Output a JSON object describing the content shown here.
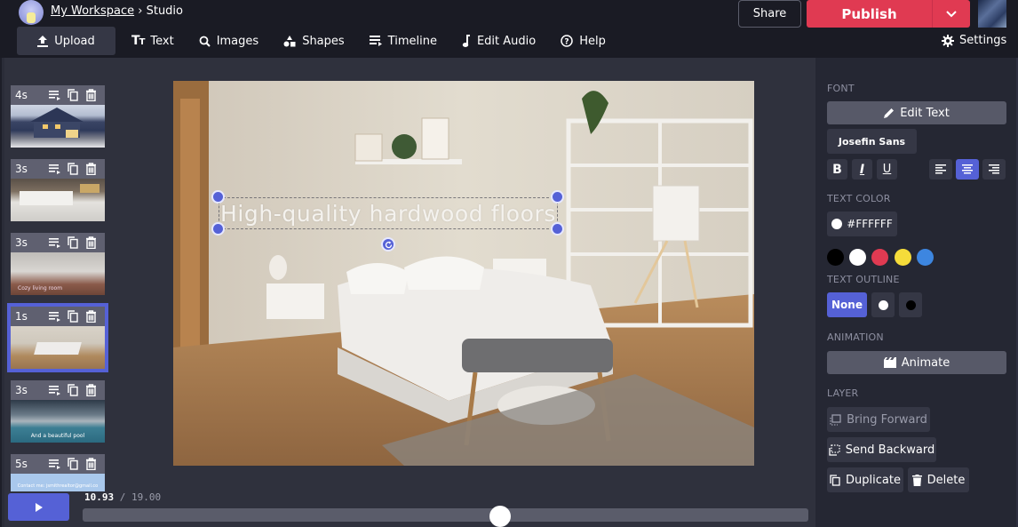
{
  "header": {
    "breadcrumb": {
      "workspace": "My Workspace",
      "separator": "›",
      "current": "Studio"
    },
    "share_label": "Share",
    "publish_label": "Publish",
    "settings_label": "Settings"
  },
  "nav": {
    "items": [
      {
        "label": "Upload",
        "icon": "upload-icon"
      },
      {
        "label": "Text",
        "icon": "text-icon"
      },
      {
        "label": "Images",
        "icon": "search-icon"
      },
      {
        "label": "Shapes",
        "icon": "shapes-icon"
      },
      {
        "label": "Timeline",
        "icon": "timeline-icon"
      },
      {
        "label": "Edit Audio",
        "icon": "music-note-icon"
      },
      {
        "label": "Help",
        "icon": "help-icon"
      }
    ]
  },
  "slides": [
    {
      "duration": "4s",
      "scene": "house exterior",
      "caption": "",
      "selected": false
    },
    {
      "duration": "3s",
      "scene": "kitchen",
      "caption": "",
      "selected": false
    },
    {
      "duration": "3s",
      "scene": "living room",
      "caption": "Cozy living room",
      "selected": false
    },
    {
      "duration": "1s",
      "scene": "bedroom",
      "caption": "",
      "selected": true
    },
    {
      "duration": "3s",
      "scene": "pool house",
      "caption": "And a beautiful pool",
      "selected": false
    },
    {
      "duration": "5s",
      "scene": "contact card",
      "caption": "Contact me: jsmithrealtor@gmail.co",
      "selected": false
    }
  ],
  "canvas": {
    "headline": "High-quality hardwood floors",
    "text_color": "#FFFFFF"
  },
  "playback": {
    "current": "10.93",
    "separator": "/",
    "total": "19.00",
    "progress_fraction": 0.575
  },
  "panel": {
    "font_section": "FONT",
    "edit_text_label": "Edit Text",
    "font_name": "Josefin Sans",
    "style_buttons": [
      "B",
      "I",
      "U"
    ],
    "alignment": {
      "options": [
        "left",
        "center",
        "right"
      ],
      "selected": "center"
    },
    "text_color_section": "TEXT COLOR",
    "text_color_value": "#FFFFFF",
    "swatches": [
      "#000000",
      "#FFFFFF",
      "#E03A52",
      "#F5DC3A",
      "#3D86E0"
    ],
    "text_outline_section": "TEXT OUTLINE",
    "outline_options": [
      {
        "label": "None",
        "selected": true
      },
      {
        "label": "",
        "color": "#FFFFFF",
        "selected": false
      },
      {
        "label": "",
        "color": "#000000",
        "selected": false
      }
    ],
    "animation_section": "ANIMATION",
    "animate_label": "Animate",
    "layer_section": "LAYER",
    "bring_forward_label": "Bring Forward",
    "send_backward_label": "Send Backward",
    "duplicate_label": "Duplicate",
    "delete_label": "Delete"
  },
  "colors": {
    "accent": "#5561D6",
    "publish": "#E03A52",
    "background": "#1A1B24",
    "panel": "#252733"
  }
}
